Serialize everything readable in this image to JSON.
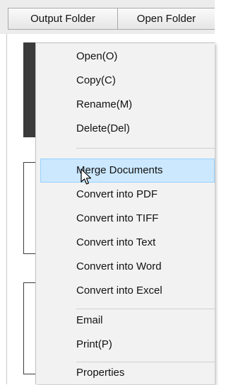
{
  "toolbar": {
    "output_folder_label": "Output Folder",
    "open_folder_label": "Open Folder"
  },
  "context_menu": {
    "items": [
      {
        "label": "Open(O)"
      },
      {
        "label": "Copy(C)"
      },
      {
        "label": "Rename(M)"
      },
      {
        "label": "Delete(Del)"
      },
      {
        "label": "Merge Documents",
        "highlighted": true
      },
      {
        "label": "Convert into PDF"
      },
      {
        "label": "Convert into TIFF"
      },
      {
        "label": "Convert into Text"
      },
      {
        "label": "Convert into Word"
      },
      {
        "label": "Convert into Excel"
      },
      {
        "label": "Email"
      },
      {
        "label": "Print(P)"
      },
      {
        "label": "Properties"
      }
    ]
  },
  "colors": {
    "highlight_fill": "#cce8ff",
    "highlight_border": "#99d1ff",
    "menu_background": "#f2f2f2",
    "thumbnail_dark": "#3b3b3b"
  },
  "icons": {
    "cursor": "mouse-pointer-icon",
    "scroll": "scroll-up-arrow-icon"
  }
}
